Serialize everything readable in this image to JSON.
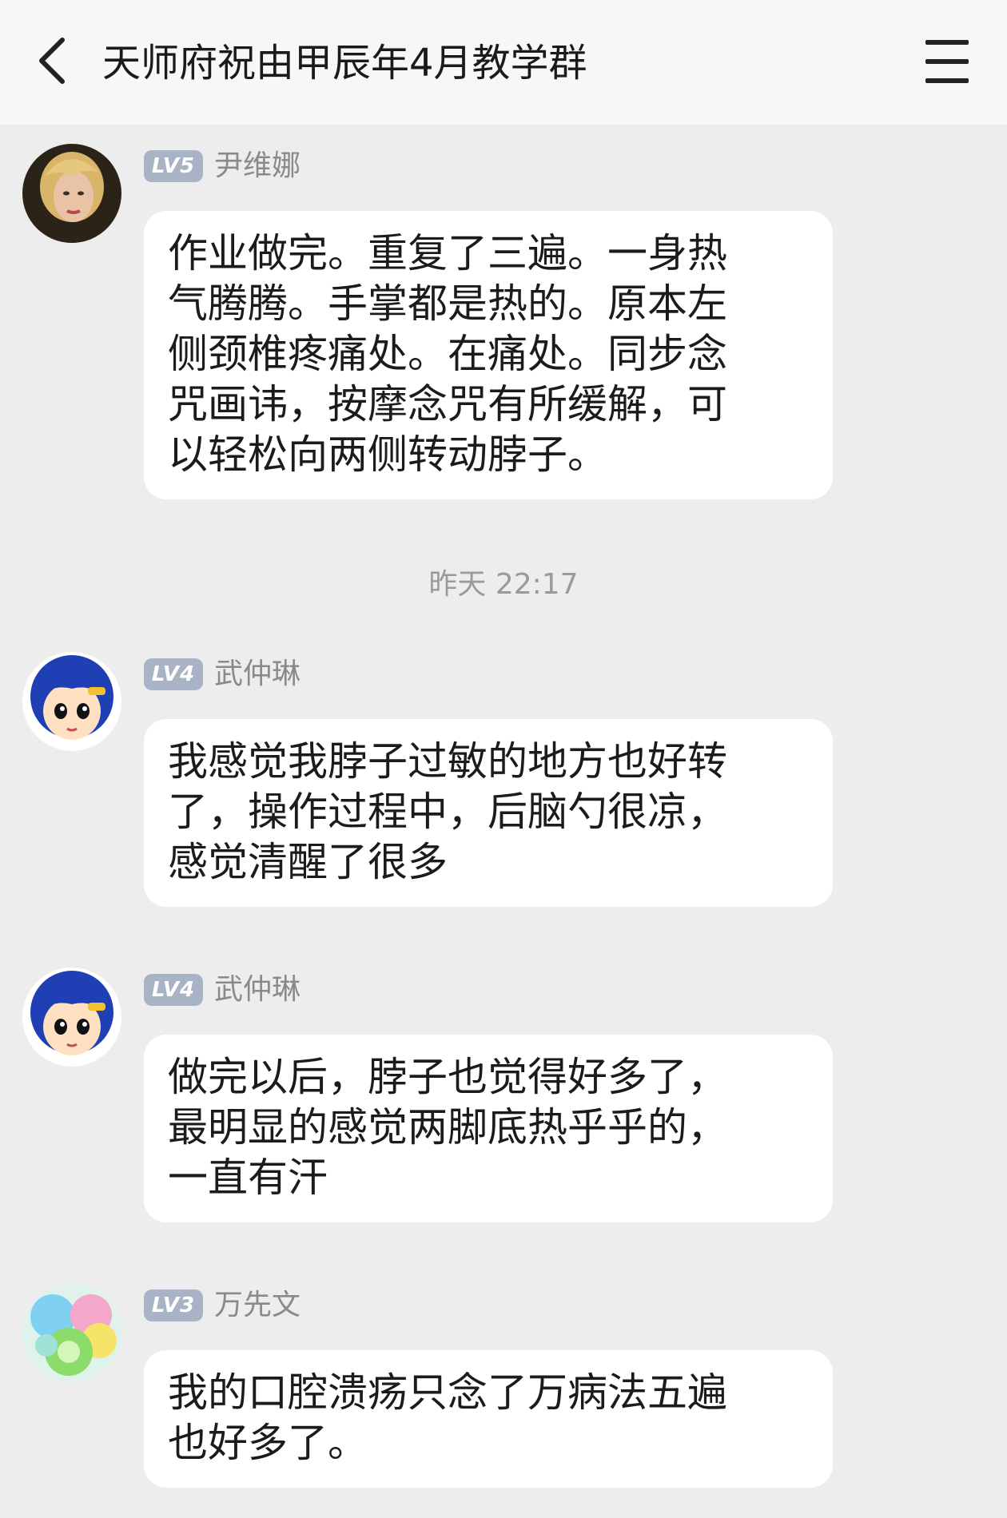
{
  "header": {
    "title": "天师府祝由甲辰年4月教学群",
    "back_icon": "chevron-left-icon",
    "menu_icon": "hamburger-menu-icon"
  },
  "messages": [
    {
      "level": "LV5",
      "sender": "尹维娜",
      "avatar": "portrait-avatar",
      "text": "作业做完。重复了三遍。一身热\n气腾腾。手掌都是热的。原本左\n侧颈椎疼痛处。在痛处。同步念\n咒画讳，按摩念咒有所缓解，可\n以轻松向两侧转动脖子。"
    },
    {
      "level": "LV4",
      "sender": "武仲琳",
      "avatar": "cartoon-avatar",
      "text": "我感觉我脖子过敏的地方也好转\n了，操作过程中，后脑勺很凉，\n感觉清醒了很多"
    },
    {
      "level": "LV4",
      "sender": "武仲琳",
      "avatar": "cartoon-avatar",
      "text": "做完以后，脖子也觉得好多了，\n最明显的感觉两脚底热乎乎的，\n一直有汗"
    },
    {
      "level": "LV3",
      "sender": "万先文",
      "avatar": "candy-avatar",
      "text": "我的口腔溃疡只念了万病法五遍\n也好多了。"
    }
  ],
  "timestamp": "昨天 22:17",
  "colors": {
    "background": "#ededed",
    "header": "#f7f7f7",
    "bubble": "#ffffff",
    "level_badge": "#a9b3c6",
    "sender_text": "#8a8a8a"
  }
}
